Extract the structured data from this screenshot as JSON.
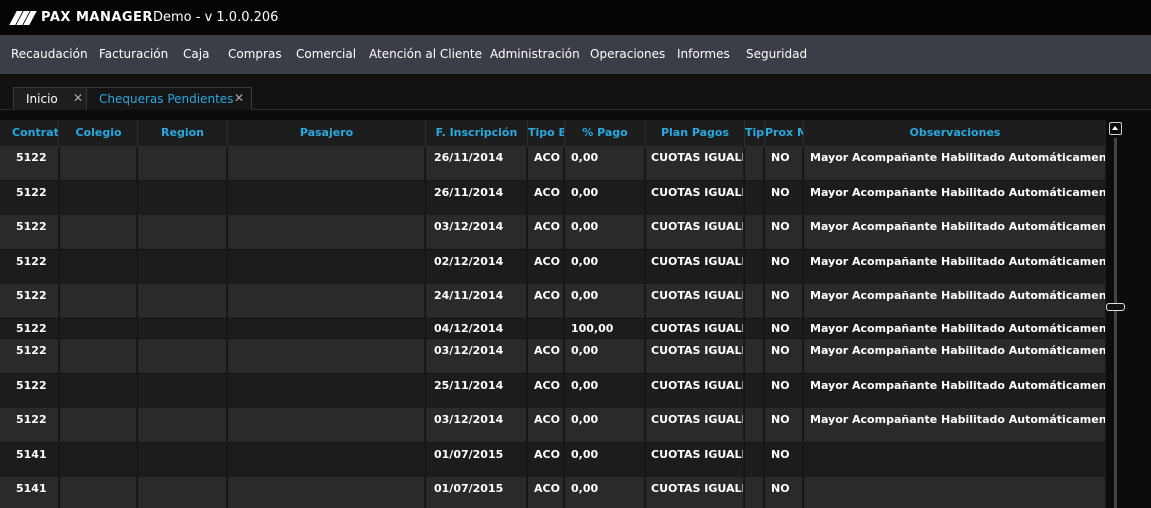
{
  "app": {
    "brand": "PAX MANAGER",
    "title": "Demo - v 1.0.0.206"
  },
  "menu": [
    "Recaudación",
    "Facturación",
    "Caja",
    "Compras",
    "Comercial",
    "Atención al Cliente",
    "Administración",
    "Operaciones",
    "Informes",
    "Seguridad"
  ],
  "tabs": [
    {
      "label": "Inicio",
      "close": "✕"
    },
    {
      "label": "Chequeras Pendientes",
      "close": "✕"
    }
  ],
  "table": {
    "columns": [
      "Contrato",
      "Colegio",
      "Region",
      "Pasajero",
      "F. Inscripción",
      "Tipo B",
      "% Pago",
      "Plan Pagos",
      "Tip",
      "Prox M",
      "Observaciones"
    ],
    "rows": [
      [
        "5122",
        "",
        "",
        "",
        "26/11/2014",
        "ACO",
        "0,00",
        "CUOTAS IGUALES",
        "",
        "NO",
        "Mayor Acompañante Habilitado Automáticamente.||OC:"
      ],
      [
        "5122",
        "",
        "",
        "",
        "26/11/2014",
        "ACO",
        "0,00",
        "CUOTAS IGUALES",
        "",
        "NO",
        "Mayor Acompañante Habilitado Automáticamente.||OC:"
      ],
      [
        "5122",
        "",
        "",
        "",
        "03/12/2014",
        "ACO",
        "0,00",
        "CUOTAS IGUALES",
        "",
        "NO",
        "Mayor Acompañante Habilitado Automáticamente.||OC:"
      ],
      [
        "5122",
        "",
        "",
        "",
        "02/12/2014",
        "ACO",
        "0,00",
        "CUOTAS IGUALES",
        "",
        "NO",
        "Mayor Acompañante Habilitado Automáticamente.||OC:"
      ],
      [
        "5122",
        "",
        "",
        "",
        "24/11/2014",
        "ACO",
        "0,00",
        "CUOTAS IGUALES",
        "",
        "NO",
        "Mayor Acompañante Habilitado Automáticamente.||OC:"
      ],
      [
        "5122",
        "",
        "",
        "",
        "04/12/2014",
        "",
        "100,00",
        "CUOTAS IGUALES",
        "",
        "NO",
        "Mayor Acompañante Habilitado Automáticamente.||OC:"
      ],
      [
        "5122",
        "",
        "",
        "",
        "03/12/2014",
        "ACO",
        "0,00",
        "CUOTAS IGUALES",
        "",
        "NO",
        "Mayor Acompañante Habilitado Automáticamente.||OC:"
      ],
      [
        "5122",
        "",
        "",
        "",
        "25/11/2014",
        "ACO",
        "0,00",
        "CUOTAS IGUALES",
        "",
        "NO",
        "Mayor Acompañante Habilitado Automáticamente.||OC:"
      ],
      [
        "5122",
        "",
        "",
        "",
        "03/12/2014",
        "ACO",
        "0,00",
        "CUOTAS IGUALES",
        "",
        "NO",
        "Mayor Acompañante Habilitado Automáticamente.||OC:"
      ],
      [
        "5141",
        "",
        "",
        "",
        "01/07/2015",
        "ACO",
        "0,00",
        "CUOTAS IGUALES",
        "",
        "NO",
        ""
      ],
      [
        "5141",
        "",
        "",
        "",
        "01/07/2015",
        "ACO",
        "0,00",
        "CUOTAS IGUALES",
        "",
        "NO",
        ""
      ]
    ]
  },
  "colors": {
    "accent": "#29a9e0",
    "menubar": "#3b3d47",
    "header_text": "#29a9e0"
  },
  "icons": {
    "close": "close-icon",
    "scroll_up": "scroll-up-icon",
    "logo": "logo-icon"
  }
}
